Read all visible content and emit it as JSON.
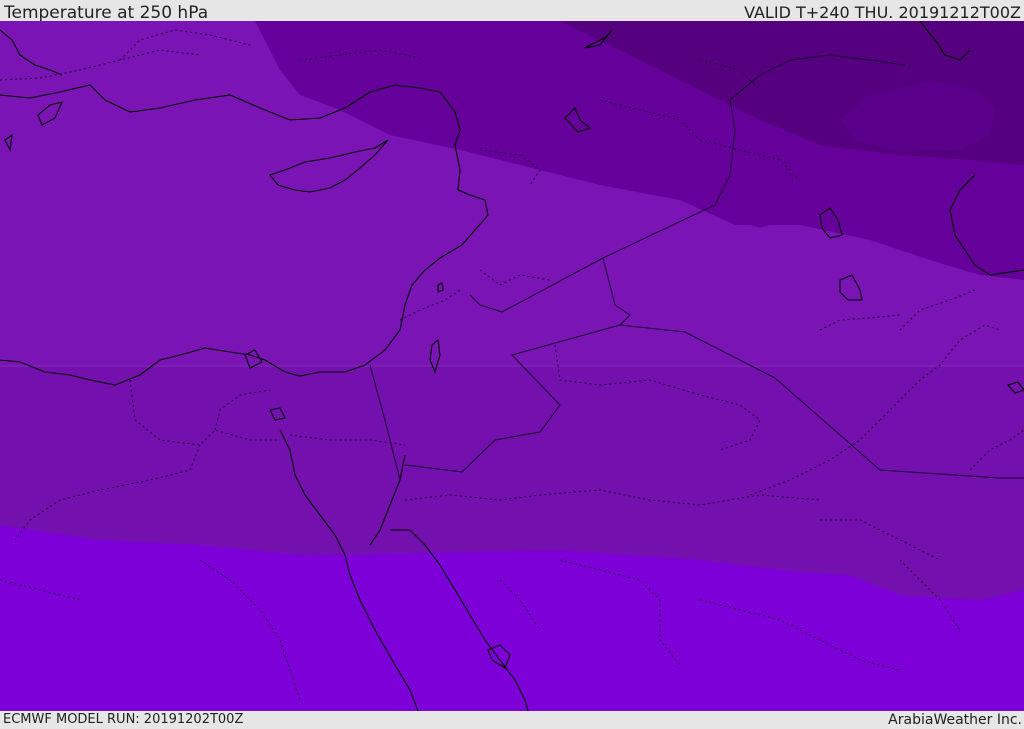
{
  "header": {
    "title": "Temperature at 250 hPa",
    "valid": "VALID T+240 THU. 20191212T00Z"
  },
  "footer": {
    "model_run": "ECMWF MODEL RUN: 20191202T00Z",
    "credit": "ArabiaWeather Inc."
  },
  "map": {
    "colors": {
      "coldest": "#55007f",
      "colder": "#66009a",
      "cold": "#7410ad",
      "mid": "#7a14b4",
      "warm": "#7d00d9",
      "coastline": "#000000",
      "border": "#1a0030"
    }
  }
}
